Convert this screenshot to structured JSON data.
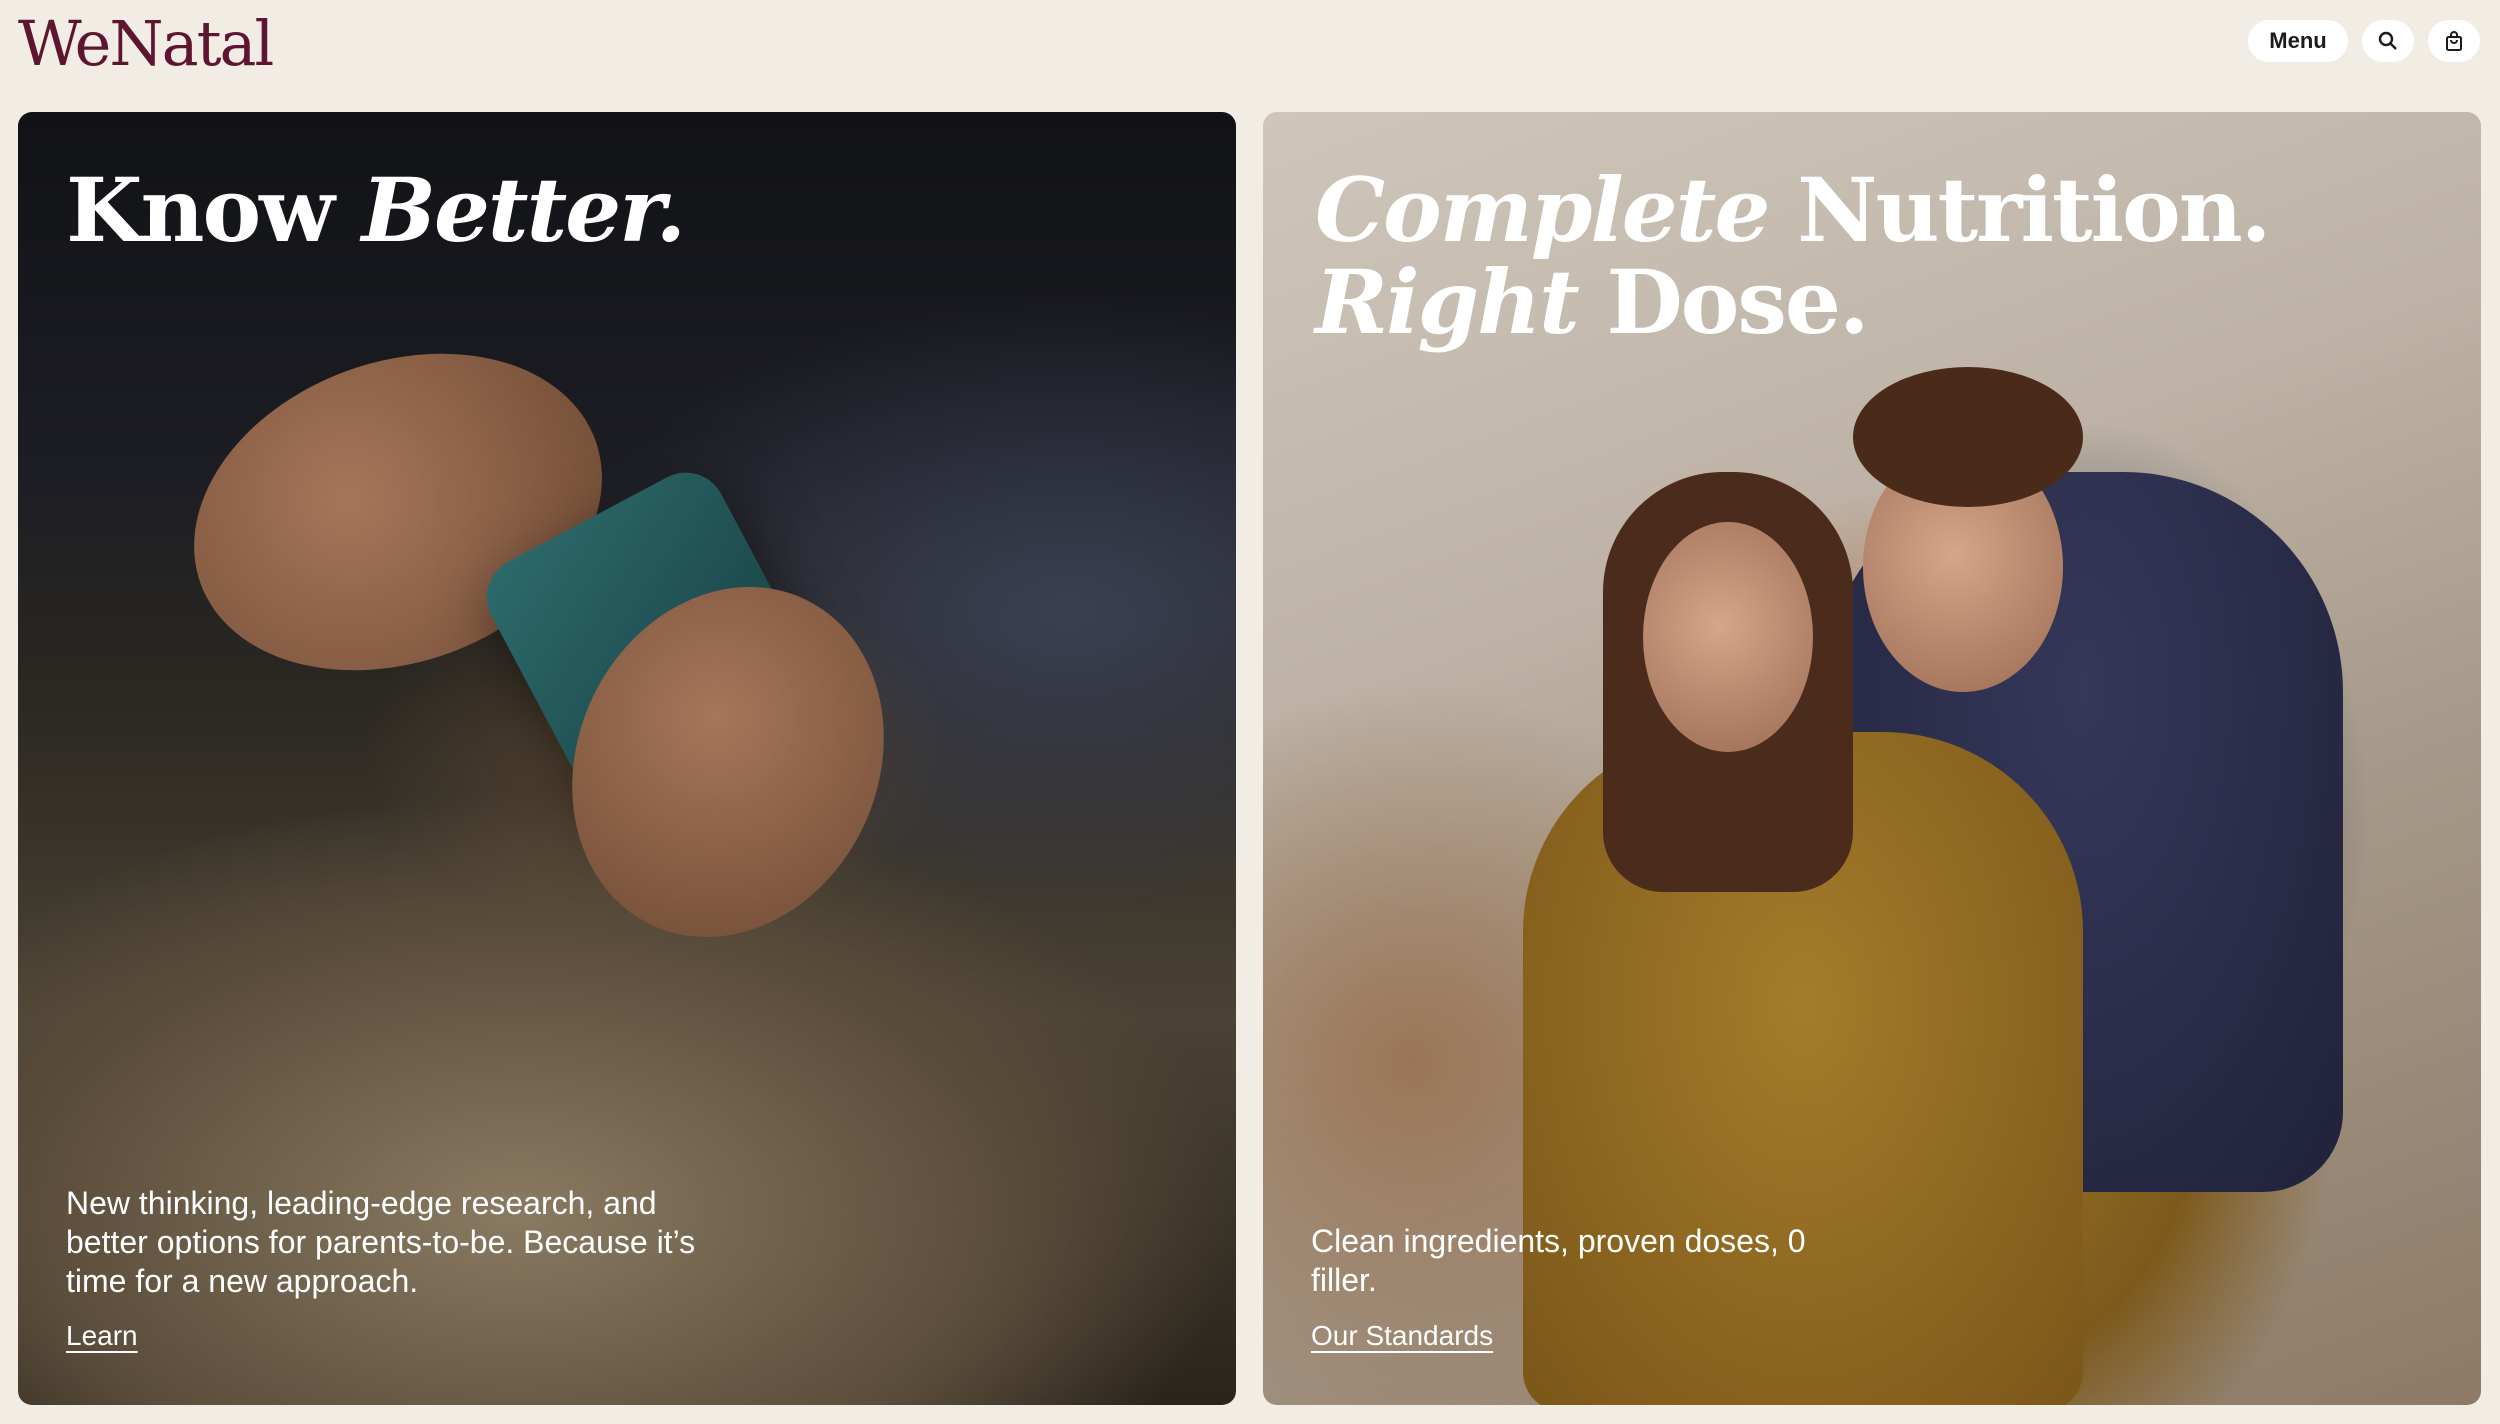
{
  "header": {
    "logo_text": "WeNatal",
    "menu_label": "Menu",
    "search_icon": "search-icon",
    "cart_icon": "shopping-bag-icon"
  },
  "cards": {
    "left": {
      "headline_regular": "Know ",
      "headline_italic": "Better.",
      "body": "New thinking, leading-edge research, and better options for parents-to-be. Because it’s time for a new approach.",
      "link_label": "Learn"
    },
    "right": {
      "headline_line1_italic": "Complete",
      "headline_line1_regular": " Nutrition.",
      "headline_line2_italic": "Right",
      "headline_line2_regular": " Dose.",
      "body": "Clean ingredients, proven doses, 0 filler.",
      "link_label": "Our Standards"
    }
  },
  "colors": {
    "background": "#f1ede5",
    "brand": "#5e1530",
    "text_on_image": "#ffffff"
  }
}
